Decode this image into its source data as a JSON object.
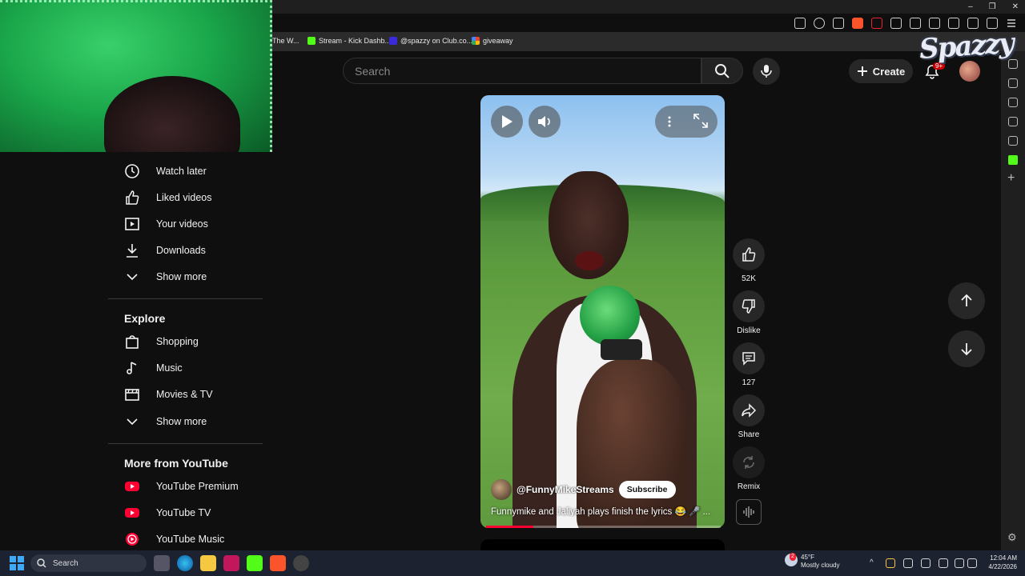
{
  "bookmarks": [
    {
      "label": "The W...",
      "color": "#cc3b3b"
    },
    {
      "label": "Stream - Kick Dashb...",
      "color": "#53fc18"
    },
    {
      "label": "@spazzy on Club.co...",
      "color": "#3b2ad9"
    },
    {
      "label": "giveaway",
      "color": "#ea4335"
    }
  ],
  "header": {
    "search_placeholder": "Search",
    "create_label": "Create",
    "notification_count": "9+",
    "watermark": "Spazzy"
  },
  "sidebar": {
    "you_items": [
      {
        "label": "Watch later",
        "icon": "clock-icon"
      },
      {
        "label": "Liked videos",
        "icon": "thumb-up-icon"
      },
      {
        "label": "Your videos",
        "icon": "play-box-icon"
      },
      {
        "label": "Downloads",
        "icon": "download-icon"
      },
      {
        "label": "Show more",
        "icon": "chevron-down-icon"
      }
    ],
    "explore_title": "Explore",
    "explore_items": [
      {
        "label": "Shopping",
        "icon": "shopping-bag-icon"
      },
      {
        "label": "Music",
        "icon": "music-note-icon"
      },
      {
        "label": "Movies & TV",
        "icon": "clapperboard-icon"
      },
      {
        "label": "Show more",
        "icon": "chevron-down-icon"
      }
    ],
    "more_title": "More from YouTube",
    "more_items": [
      {
        "label": "YouTube Premium",
        "icon": "youtube-premium-icon"
      },
      {
        "label": "YouTube TV",
        "icon": "youtube-tv-icon"
      },
      {
        "label": "YouTube Music",
        "icon": "youtube-music-icon"
      }
    ]
  },
  "short": {
    "channel": "@FunnyMikeStreams",
    "subscribe_label": "Subscribe",
    "caption": "Funnymike and Jaliyah plays finish the lyrics 😂 🎤 ...",
    "progress": 0.2
  },
  "actions": {
    "like_count": "52K",
    "dislike_label": "Dislike",
    "comment_count": "127",
    "share_label": "Share",
    "remix_label": "Remix"
  },
  "taskbar": {
    "search_label": "Search",
    "weather_temp": "45°F",
    "weather_desc": "Mostly cloudy",
    "weather_badge": "2",
    "time": "12:04 AM",
    "date": "4/22/2026"
  },
  "colors": {
    "accent_red": "#ff0033",
    "kick_green": "#53fc18",
    "panel": "#272727"
  }
}
